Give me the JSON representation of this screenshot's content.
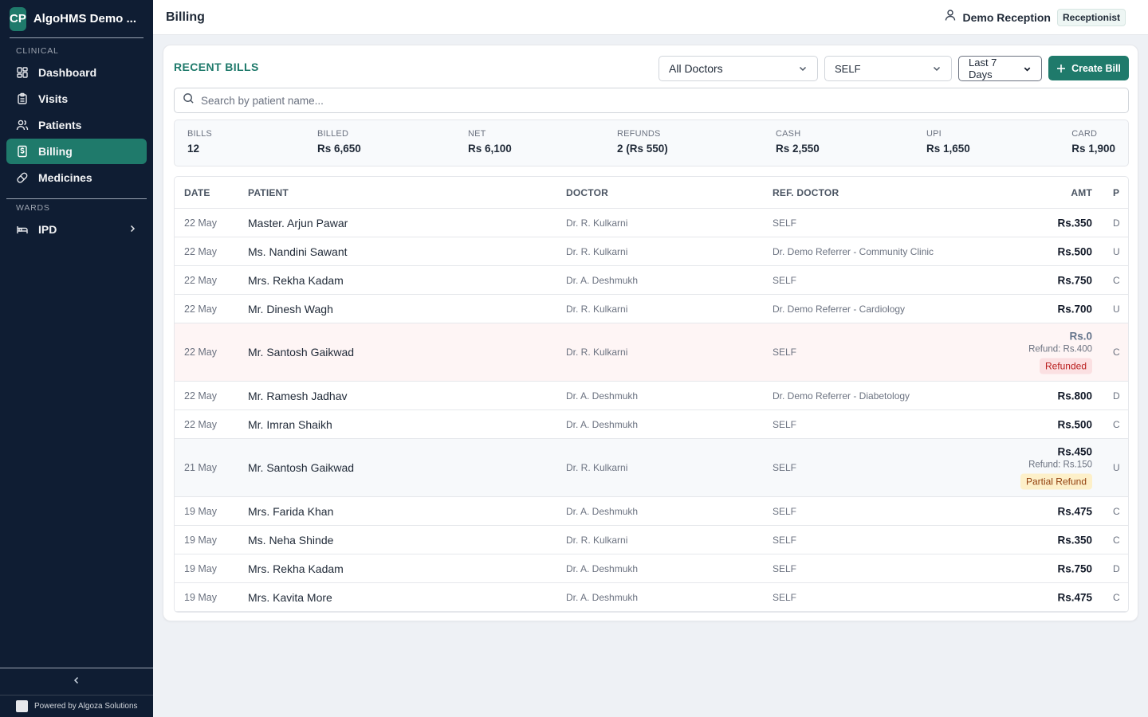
{
  "sidebar": {
    "brand_initials": "CP",
    "brand_name": "AlgoHMS Demo ...",
    "section_clinical": "CLINICAL",
    "section_wards": "WARDS",
    "items": [
      {
        "label": "Dashboard",
        "icon": "dashboard-icon"
      },
      {
        "label": "Visits",
        "icon": "clipboard-icon"
      },
      {
        "label": "Patients",
        "icon": "users-icon"
      },
      {
        "label": "Billing",
        "icon": "billing-icon",
        "active": true
      },
      {
        "label": "Medicines",
        "icon": "pill-icon"
      }
    ],
    "ipd_label": "IPD",
    "powered_by": "Powered by Algoza Solutions"
  },
  "header": {
    "title": "Billing",
    "user_name": "Demo Reception",
    "role": "Receptionist"
  },
  "toolbar": {
    "section_title": "RECENT BILLS",
    "doctor_filter": "All Doctors",
    "ref_filter": "SELF",
    "date_filter": "Last 7 Days",
    "create_label": "Create Bill",
    "search_placeholder": "Search by patient name..."
  },
  "summary": {
    "bills_label": "BILLS",
    "bills": "12",
    "billed_label": "BILLED",
    "billed": "Rs 6,650",
    "net_label": "NET",
    "net": "Rs 6,100",
    "refunds_label": "REFUNDS",
    "refunds": "2 (Rs 550)",
    "cash_label": "CASH",
    "cash": "Rs 2,550",
    "upi_label": "UPI",
    "upi": "Rs 1,650",
    "card_label": "CARD",
    "card": "Rs 1,900"
  },
  "table": {
    "headers": {
      "date": "DATE",
      "patient": "PATIENT",
      "doctor": "DOCTOR",
      "ref": "REF. DOCTOR",
      "amt": "AMT",
      "pay": "P"
    },
    "rows": [
      {
        "date": "22 May",
        "patient": "Master. Arjun Pawar",
        "doctor": "Dr. R. Kulkarni",
        "ref": "SELF",
        "amt": "Rs.350",
        "pay": "D"
      },
      {
        "date": "22 May",
        "patient": "Ms. Nandini Sawant",
        "doctor": "Dr. R. Kulkarni",
        "ref": "Dr. Demo Referrer - Community Clinic",
        "amt": "Rs.500",
        "pay": "U"
      },
      {
        "date": "22 May",
        "patient": "Mrs. Rekha Kadam",
        "doctor": "Dr. A. Deshmukh",
        "ref": "SELF",
        "amt": "Rs.750",
        "pay": "C"
      },
      {
        "date": "22 May",
        "patient": "Mr. Dinesh Wagh",
        "doctor": "Dr. R. Kulkarni",
        "ref": "Dr. Demo Referrer - Cardiology",
        "amt": "Rs.700",
        "pay": "U"
      },
      {
        "date": "22 May",
        "patient": "Mr. Santosh Gaikwad",
        "doctor": "Dr. R. Kulkarni",
        "ref": "SELF",
        "amt": "Rs.0",
        "refund": "Refund: Rs.400",
        "status": "Refunded",
        "pay": "C"
      },
      {
        "date": "22 May",
        "patient": "Mr. Ramesh Jadhav",
        "doctor": "Dr. A. Deshmukh",
        "ref": "Dr. Demo Referrer - Diabetology",
        "amt": "Rs.800",
        "pay": "D"
      },
      {
        "date": "22 May",
        "patient": "Mr. Imran Shaikh",
        "doctor": "Dr. A. Deshmukh",
        "ref": "SELF",
        "amt": "Rs.500",
        "pay": "C"
      },
      {
        "date": "21 May",
        "patient": "Mr. Santosh Gaikwad",
        "doctor": "Dr. R. Kulkarni",
        "ref": "SELF",
        "amt": "Rs.450",
        "refund": "Refund: Rs.150",
        "status": "Partial Refund",
        "pay": "U"
      },
      {
        "date": "19 May",
        "patient": "Mrs. Farida Khan",
        "doctor": "Dr. A. Deshmukh",
        "ref": "SELF",
        "amt": "Rs.475",
        "pay": "C"
      },
      {
        "date": "19 May",
        "patient": "Ms. Neha Shinde",
        "doctor": "Dr. R. Kulkarni",
        "ref": "SELF",
        "amt": "Rs.350",
        "pay": "C"
      },
      {
        "date": "19 May",
        "patient": "Mrs. Rekha Kadam",
        "doctor": "Dr. A. Deshmukh",
        "ref": "SELF",
        "amt": "Rs.750",
        "pay": "D"
      },
      {
        "date": "19 May",
        "patient": "Mrs. Kavita More",
        "doctor": "Dr. A. Deshmukh",
        "ref": "SELF",
        "amt": "Rs.475",
        "pay": "C"
      }
    ]
  },
  "colors": {
    "accent": "#1f7a6b",
    "sidebar_bg": "#0f1d33",
    "refund_red": "#b91c1c",
    "partial_amber": "#92400e"
  }
}
